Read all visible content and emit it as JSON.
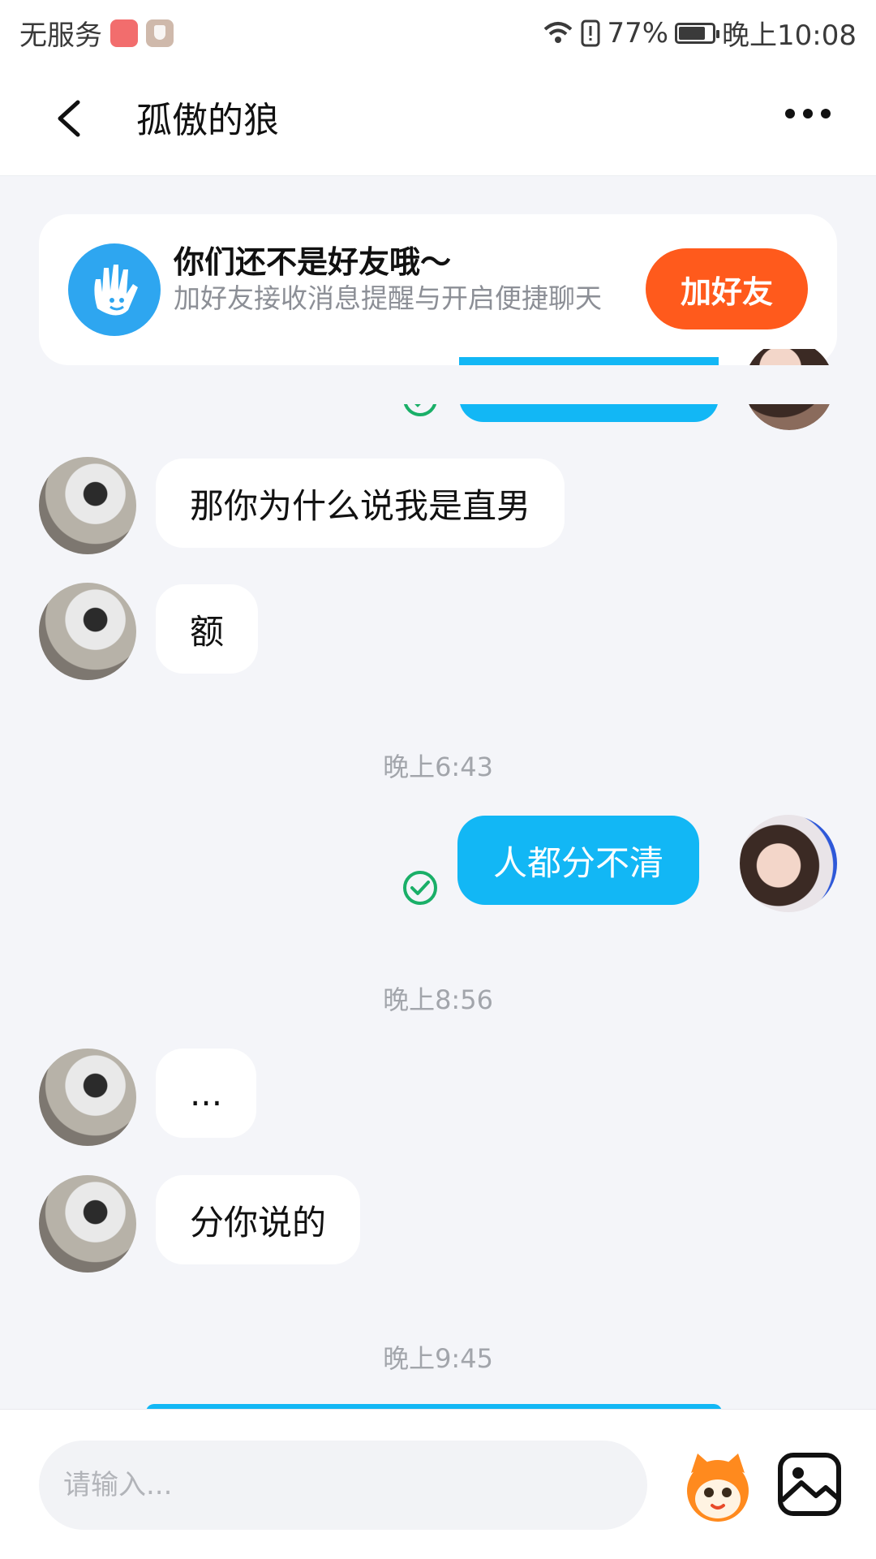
{
  "status_bar": {
    "carrier": "无服务",
    "battery_percent": "77%",
    "time": "晚上10:08",
    "icons": [
      "huawei-store-icon",
      "shield-app-icon",
      "wifi-icon",
      "alert-icon",
      "battery-icon"
    ]
  },
  "header": {
    "title": "孤傲的狼",
    "back_icon": "back-arrow-icon",
    "more_icon": "more-dots-icon"
  },
  "banner": {
    "title": "你们还不是好友哦～",
    "subtitle": "加好友接收消息提醒与开启便捷聊天",
    "button_label": "加好友",
    "icon": "wave-hand-icon",
    "accent_color": "#ff5a1c"
  },
  "messages": [
    {
      "side": "in",
      "text": "那你为什么说我是直男"
    },
    {
      "side": "in",
      "text": "额"
    },
    {
      "type": "time",
      "text": "晚上6:43"
    },
    {
      "side": "out",
      "text": "人都分不清",
      "status": "read"
    },
    {
      "type": "time",
      "text": "晚上8:56"
    },
    {
      "side": "in",
      "text": "..."
    },
    {
      "side": "in",
      "text": "分你说的"
    },
    {
      "type": "time",
      "text": "晚上9:45"
    }
  ],
  "input": {
    "placeholder": "请输入...",
    "value": ""
  },
  "colors": {
    "bubble_out": "#12b7f5",
    "bubble_in": "#ffffff",
    "background": "#f4f5f9",
    "read_check": "#1aaf68"
  }
}
